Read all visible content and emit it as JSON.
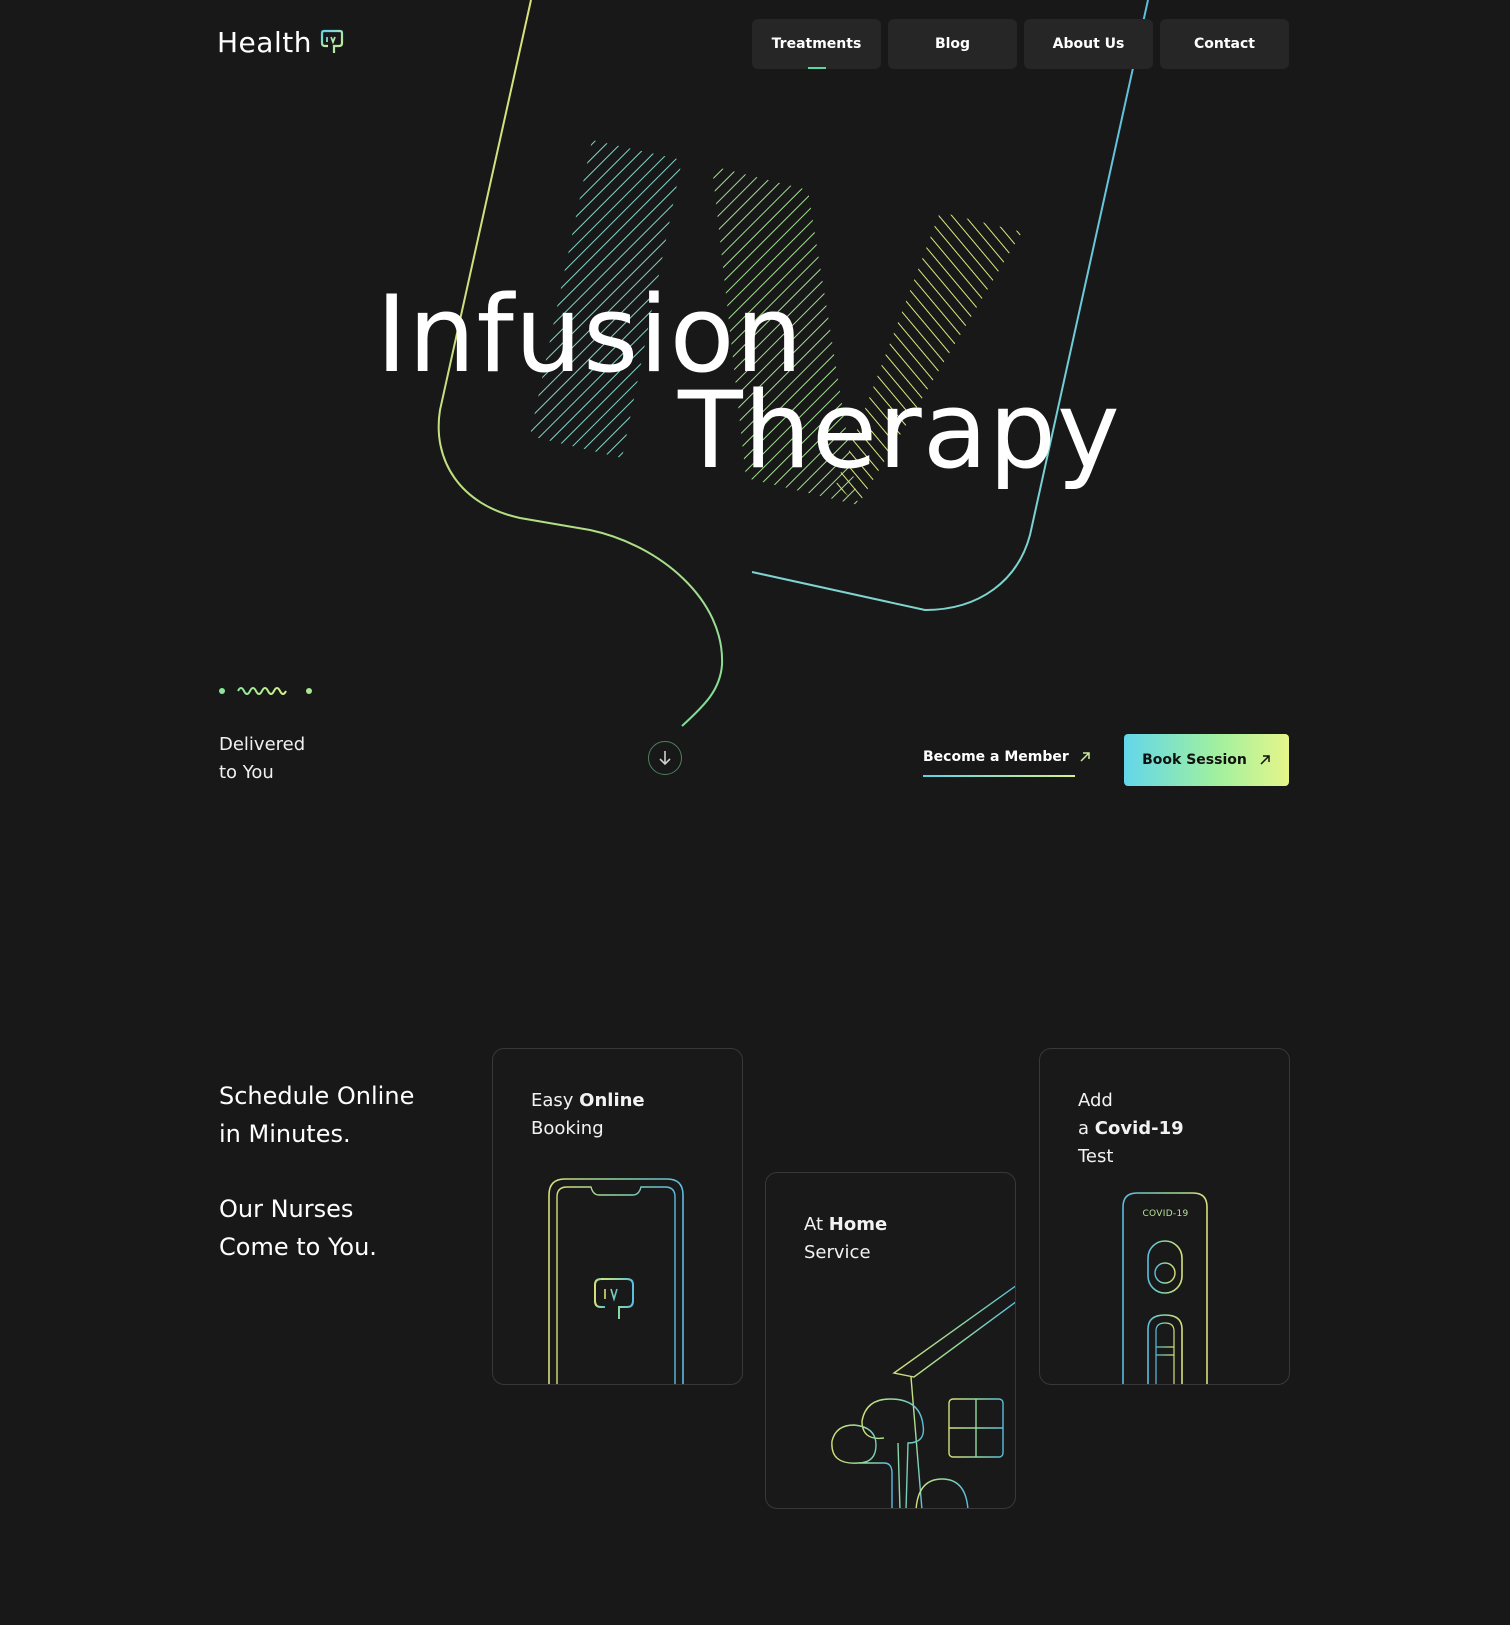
{
  "brand": {
    "name": "Health"
  },
  "nav": {
    "items": [
      {
        "label": "Treatments"
      },
      {
        "label": "Blog"
      },
      {
        "label": "About Us"
      },
      {
        "label": "Contact"
      }
    ]
  },
  "hero": {
    "title_line1": "Infusion",
    "title_line2": "Therapy",
    "tagline_line1": "Delivered",
    "tagline_line2": "to You",
    "member_link": "Become a Member",
    "book_button": "Book Session"
  },
  "schedule": {
    "heading1_line1": "Schedule Online",
    "heading1_line2": "in Minutes.",
    "heading2_line1": "Our Nurses",
    "heading2_line2": "Come to You."
  },
  "cards": [
    {
      "pre": "Easy ",
      "bold": "Online",
      "post": "Booking"
    },
    {
      "pre": "At ",
      "bold": "Home",
      "post": "Service"
    },
    {
      "pre": "Add",
      "mid": "a ",
      "bold": "Covid-19",
      "post": "Test",
      "kit_label": "COVID-19"
    }
  ],
  "colors": {
    "background": "#181818",
    "accent_cyan": "#5fd1e8",
    "accent_green": "#8ee69a",
    "accent_yellow": "#e0ee7a"
  },
  "icons": [
    "logo-icon",
    "arrow-down-icon",
    "arrow-up-right-icon",
    "squiggle-icon"
  ]
}
